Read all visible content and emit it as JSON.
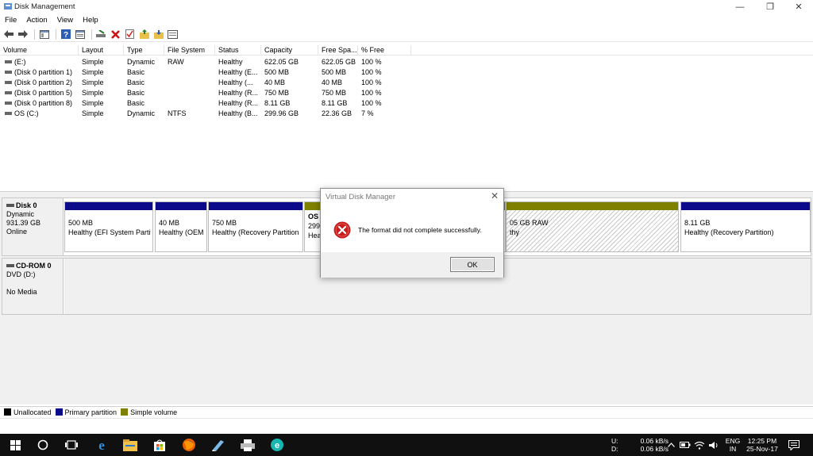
{
  "window": {
    "title": "Disk Management",
    "controls": {
      "minimize": "—",
      "restore": "❐",
      "close": "✕"
    }
  },
  "menu": [
    "File",
    "Action",
    "View",
    "Help"
  ],
  "columns": [
    "Volume",
    "Layout",
    "Type",
    "File System",
    "Status",
    "Capacity",
    "Free Spa...",
    "% Free"
  ],
  "volumes": [
    {
      "volume": "(E:)",
      "layout": "Simple",
      "type": "Dynamic",
      "fs": "RAW",
      "status": "Healthy",
      "capacity": "622.05 GB",
      "free": "622.05 GB",
      "pct": "100 %"
    },
    {
      "volume": "(Disk 0 partition 1)",
      "layout": "Simple",
      "type": "Basic",
      "fs": "",
      "status": "Healthy (E...",
      "capacity": "500 MB",
      "free": "500 MB",
      "pct": "100 %"
    },
    {
      "volume": "(Disk 0 partition 2)",
      "layout": "Simple",
      "type": "Basic",
      "fs": "",
      "status": "Healthy (...",
      "capacity": "40 MB",
      "free": "40 MB",
      "pct": "100 %"
    },
    {
      "volume": "(Disk 0 partition 5)",
      "layout": "Simple",
      "type": "Basic",
      "fs": "",
      "status": "Healthy (R...",
      "capacity": "750 MB",
      "free": "750 MB",
      "pct": "100 %"
    },
    {
      "volume": "(Disk 0 partition 8)",
      "layout": "Simple",
      "type": "Basic",
      "fs": "",
      "status": "Healthy (R...",
      "capacity": "8.11 GB",
      "free": "8.11 GB",
      "pct": "100 %"
    },
    {
      "volume": "OS (C:)",
      "layout": "Simple",
      "type": "Dynamic",
      "fs": "NTFS",
      "status": "Healthy (B...",
      "capacity": "299.96 GB",
      "free": "22.36 GB",
      "pct": "7 %"
    }
  ],
  "disk0": {
    "name": "Disk 0",
    "type": "Dynamic",
    "size": "931.39 GB",
    "state": "Online",
    "partitions": [
      {
        "line1": "500 MB",
        "line2": "Healthy (EFI System Partit"
      },
      {
        "line1": "40 MB",
        "line2": "Healthy (OEM"
      },
      {
        "line1": "750 MB",
        "line2": "Healthy (Recovery Partition"
      },
      {
        "line1": "OS",
        "line2": "299.",
        "line3": "Hea"
      },
      {
        "line1": "05 GB RAW",
        "line2": "thy"
      },
      {
        "line1": "8.11 GB",
        "line2": "Healthy (Recovery Partition)"
      }
    ]
  },
  "cdrom": {
    "name": "CD-ROM 0",
    "drive": "DVD (D:)",
    "media": "No Media"
  },
  "legend": [
    {
      "label": "Unallocated",
      "color": "#000000"
    },
    {
      "label": "Primary partition",
      "color": "#0a0a8a"
    },
    {
      "label": "Simple volume",
      "color": "#808000"
    }
  ],
  "dialog": {
    "title": "Virtual Disk Manager",
    "message": "The format did not complete successfully.",
    "ok": "OK",
    "close": "✕"
  },
  "tray": {
    "upload_label": "U:",
    "download_label": "D:",
    "upload_rate": "0.06 kB/s",
    "download_rate": "0.06 kB/s",
    "lang": "ENG",
    "region": "IN",
    "time": "12:25 PM",
    "date": "25-Nov-17"
  }
}
